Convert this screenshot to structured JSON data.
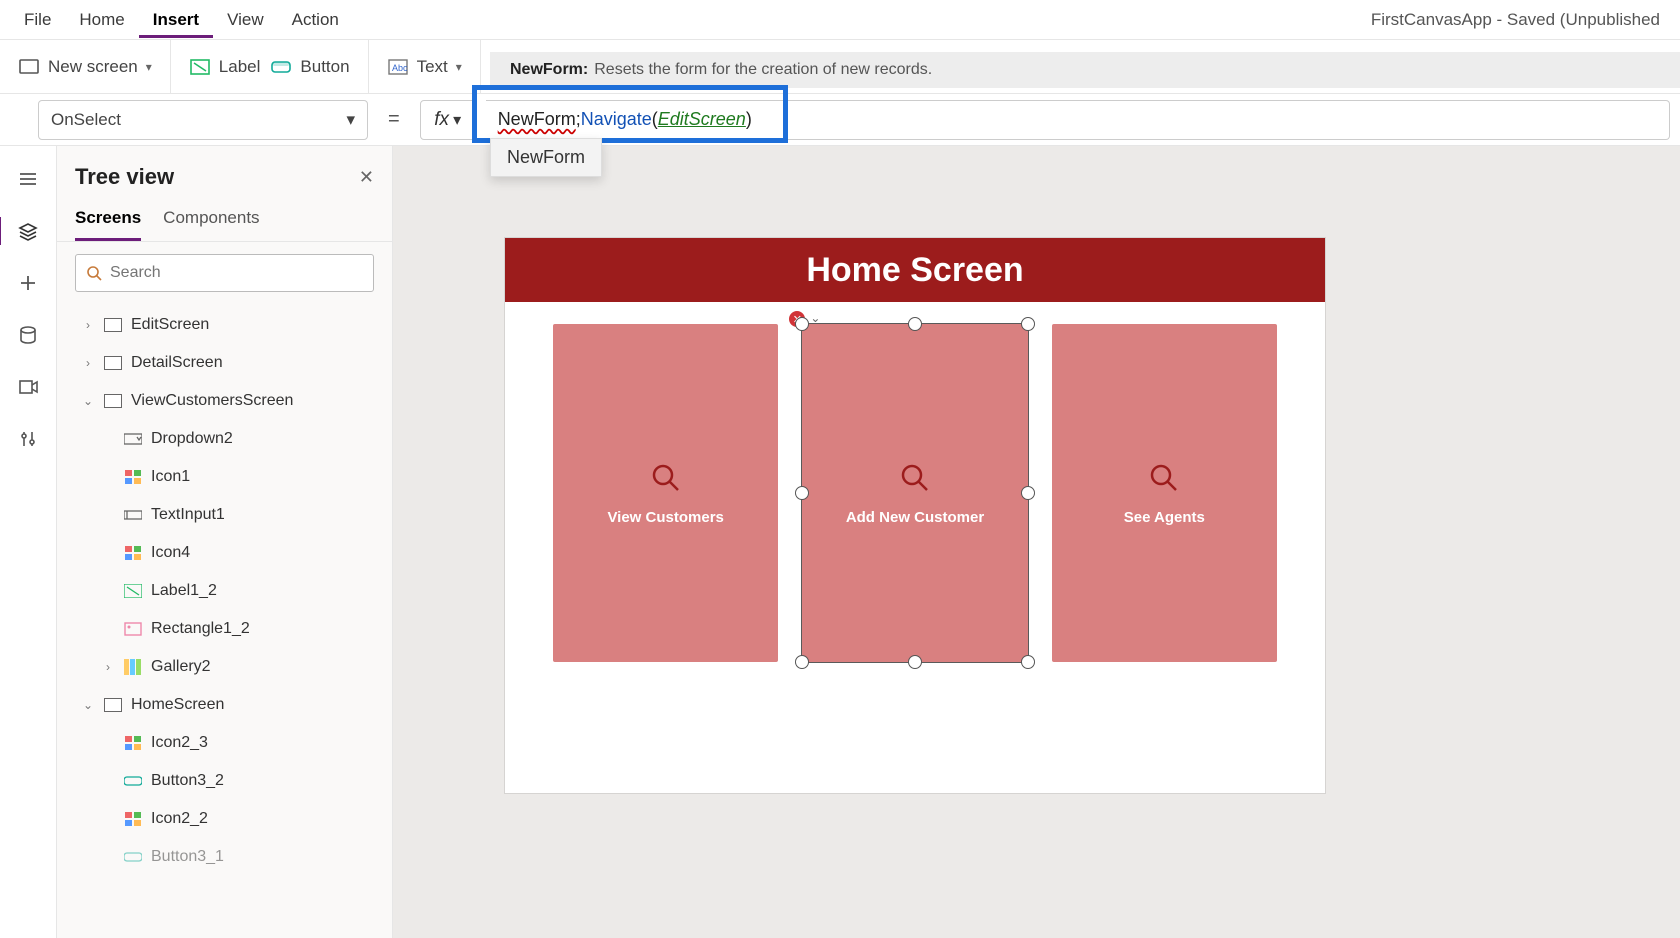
{
  "app_title": "FirstCanvasApp - Saved (Unpublished",
  "menu": {
    "items": [
      "File",
      "Home",
      "Insert",
      "View",
      "Action"
    ],
    "active": "Insert"
  },
  "ribbon": {
    "new_screen": "New screen",
    "label": "Label",
    "button": "Button",
    "text": "Text"
  },
  "tooltip": {
    "name": "NewForm:",
    "desc": "Resets the form for the creation of new records."
  },
  "property": {
    "selected": "OnSelect"
  },
  "formula": {
    "token_newform": "NewForm",
    "token_sep": ";",
    "token_nav": "Navigate",
    "token_open": "(",
    "token_arg": "EditScreen",
    "token_close": ")"
  },
  "intellisense": {
    "item": "NewForm"
  },
  "treepane": {
    "title": "Tree view",
    "tabs": {
      "screens": "Screens",
      "components": "Components"
    },
    "search_placeholder": "Search",
    "nodes": {
      "editscreen": "EditScreen",
      "detailscreen": "DetailScreen",
      "viewcustomers": "ViewCustomersScreen",
      "dropdown2": "Dropdown2",
      "icon1": "Icon1",
      "textinput1": "TextInput1",
      "icon4": "Icon4",
      "label1_2": "Label1_2",
      "rectangle1_2": "Rectangle1_2",
      "gallery2": "Gallery2",
      "homescreen": "HomeScreen",
      "icon2_3": "Icon2_3",
      "button3_2": "Button3_2",
      "icon2_2": "Icon2_2",
      "button3_1": "Button3_1"
    }
  },
  "canvas": {
    "header": "Home Screen",
    "tiles": {
      "view": "View Customers",
      "add": "Add New Customer",
      "agents": "See Agents"
    }
  }
}
